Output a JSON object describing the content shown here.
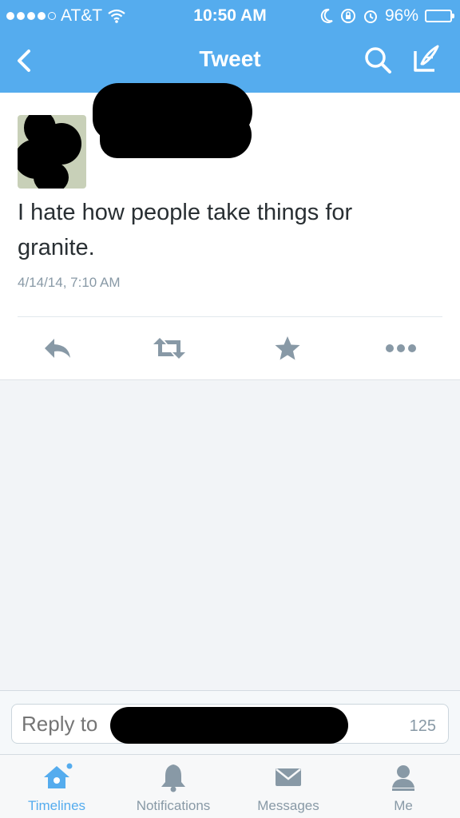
{
  "status_bar": {
    "carrier": "AT&T",
    "time": "10:50 AM",
    "battery": "96%",
    "battery_level": 0.96
  },
  "nav": {
    "title": "Tweet",
    "back_icon": "chevron-left-icon",
    "search_icon": "search-icon",
    "compose_icon": "compose-icon"
  },
  "tweet": {
    "text": "I hate how people take things for granite.",
    "timestamp": "4/14/14, 7:10 AM"
  },
  "actions": {
    "reply_icon": "reply-icon",
    "retweet_icon": "retweet-icon",
    "favorite_icon": "star-icon",
    "more_icon": "more-icon"
  },
  "reply_bar": {
    "placeholder": "Reply to",
    "char_count": "125"
  },
  "tabs": [
    {
      "label": "Timelines",
      "icon": "home-icon",
      "active": true
    },
    {
      "label": "Notifications",
      "icon": "bell-icon",
      "active": false
    },
    {
      "label": "Messages",
      "icon": "envelope-icon",
      "active": false
    },
    {
      "label": "Me",
      "icon": "person-icon",
      "active": false
    }
  ],
  "colors": {
    "brand": "#55acee",
    "text": "#292f33",
    "muted": "#8899a6",
    "icon": "#8899a6"
  }
}
